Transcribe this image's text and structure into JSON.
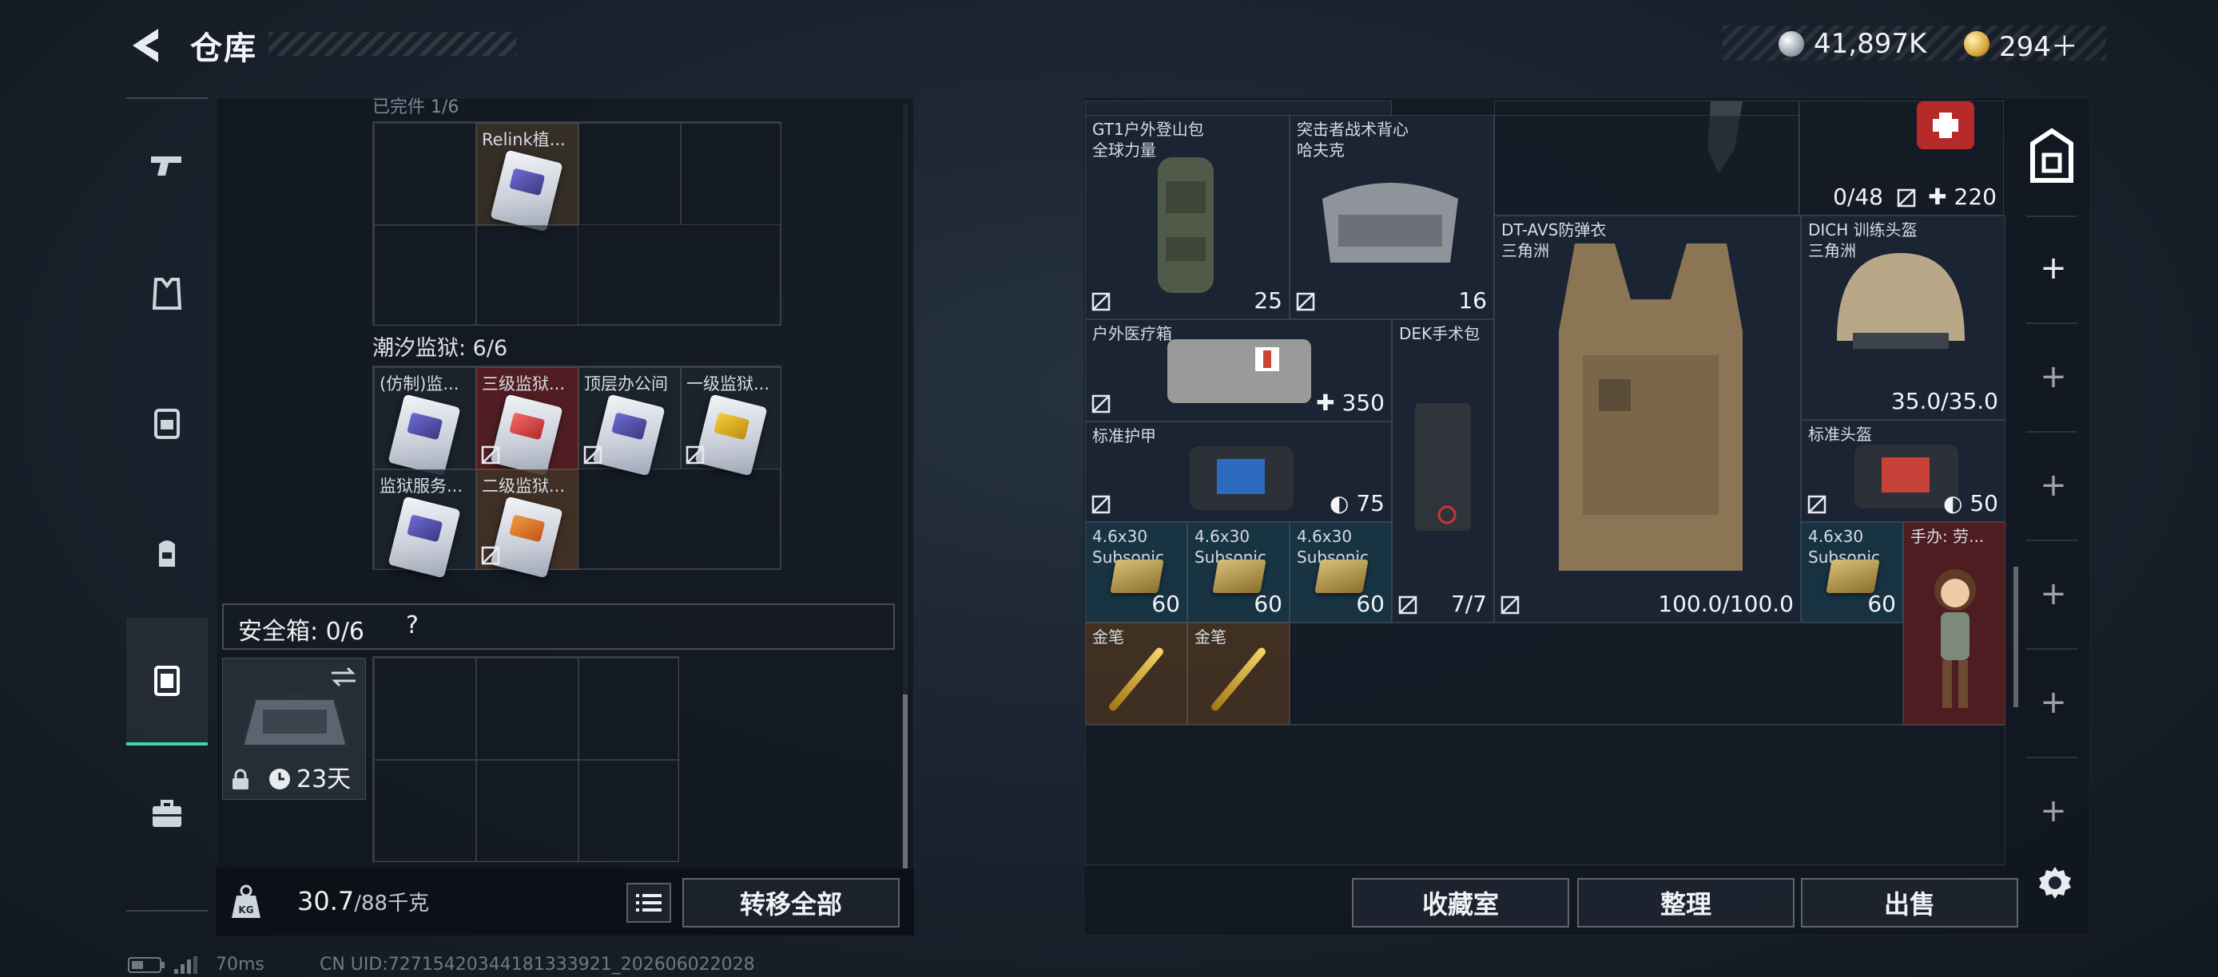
{
  "header": {
    "title": "仓库"
  },
  "currency": [
    {
      "icon": "silver-coin-icon",
      "amount": "41,897K"
    },
    {
      "icon": "gold-coin-icon",
      "amount": "294＋"
    }
  ],
  "rail_tabs": [
    {
      "name": "rail-tab-weapons",
      "icon": "pistol-icon"
    },
    {
      "name": "rail-tab-armor",
      "icon": "vest-icon"
    },
    {
      "name": "rail-tab-chest-rig",
      "icon": "chest-rig-icon"
    },
    {
      "name": "rail-tab-backpack",
      "icon": "backpack-icon"
    },
    {
      "name": "rail-tab-safebox",
      "icon": "safebox-icon",
      "active": true
    },
    {
      "name": "rail-tab-case",
      "icon": "briefcase-icon"
    }
  ],
  "left": {
    "cut_label": "已完件 1/6",
    "relink_item": "Relink植...",
    "tide_prison_label": "潮汐监狱: 6/6",
    "keycards": [
      {
        "name": "(仿制)监...",
        "color": "blue"
      },
      {
        "name": "三级监狱...",
        "color": "red"
      },
      {
        "name": "顶层办公间",
        "color": "blue"
      },
      {
        "name": "一级监狱...",
        "color": "yellow"
      },
      {
        "name": "监狱服务...",
        "color": "blue"
      },
      {
        "name": "二级监狱...",
        "color": "orange"
      }
    ],
    "safebox_label": "安全箱: 0/6",
    "help": "?",
    "safebox_days": "23天",
    "weight_value": "30.7",
    "weight_total": "/88千克",
    "transfer_all": "转移全部"
  },
  "right": {
    "top_counts": [
      "0/48",
      "220"
    ],
    "items": [
      {
        "name": "GT1户外登山包",
        "sub": "全球力量",
        "val": "25"
      },
      {
        "name": "突击者战术背心",
        "sub": "哈夫克",
        "val": "16"
      },
      {
        "name": "DT-AVS防弹衣",
        "sub": "三角洲",
        "val": "100.0/100.0"
      },
      {
        "name": "DICH 训练头盔",
        "sub": "三角洲",
        "val": "35.0/35.0"
      },
      {
        "name": "户外医疗箱",
        "sub": "",
        "val": "350"
      },
      {
        "name": "DEK手术包",
        "sub": "",
        "val": "7/7"
      },
      {
        "name": "标准护甲",
        "sub": "",
        "val": "75"
      },
      {
        "name": "标准头盔",
        "sub": "",
        "val": "50"
      },
      {
        "name": "4.6x30",
        "sub": "Subsonic",
        "val": "60"
      },
      {
        "name": "4.6x30",
        "sub": "Subsonic",
        "val": "60"
      },
      {
        "name": "4.6x30",
        "sub": "Subsonic",
        "val": "60"
      },
      {
        "name": "4.6x30",
        "sub": "Subsonic",
        "val": "60"
      },
      {
        "name": "手办: 劳...",
        "sub": "",
        "val": ""
      },
      {
        "name": "金笔",
        "sub": "",
        "val": ""
      },
      {
        "name": "金笔",
        "sub": "",
        "val": ""
      }
    ],
    "buttons": {
      "collection": "收藏室",
      "sort": "整理",
      "sell": "出售"
    }
  },
  "status": {
    "ping": "70ms",
    "uid": "CN UID:7271542034418133392​1_202606022028"
  },
  "colors": {
    "accent": "#42d3b0",
    "rare_red": "#5a1e22",
    "rare_gold": "#463422",
    "rare_teal": "#18364a"
  }
}
